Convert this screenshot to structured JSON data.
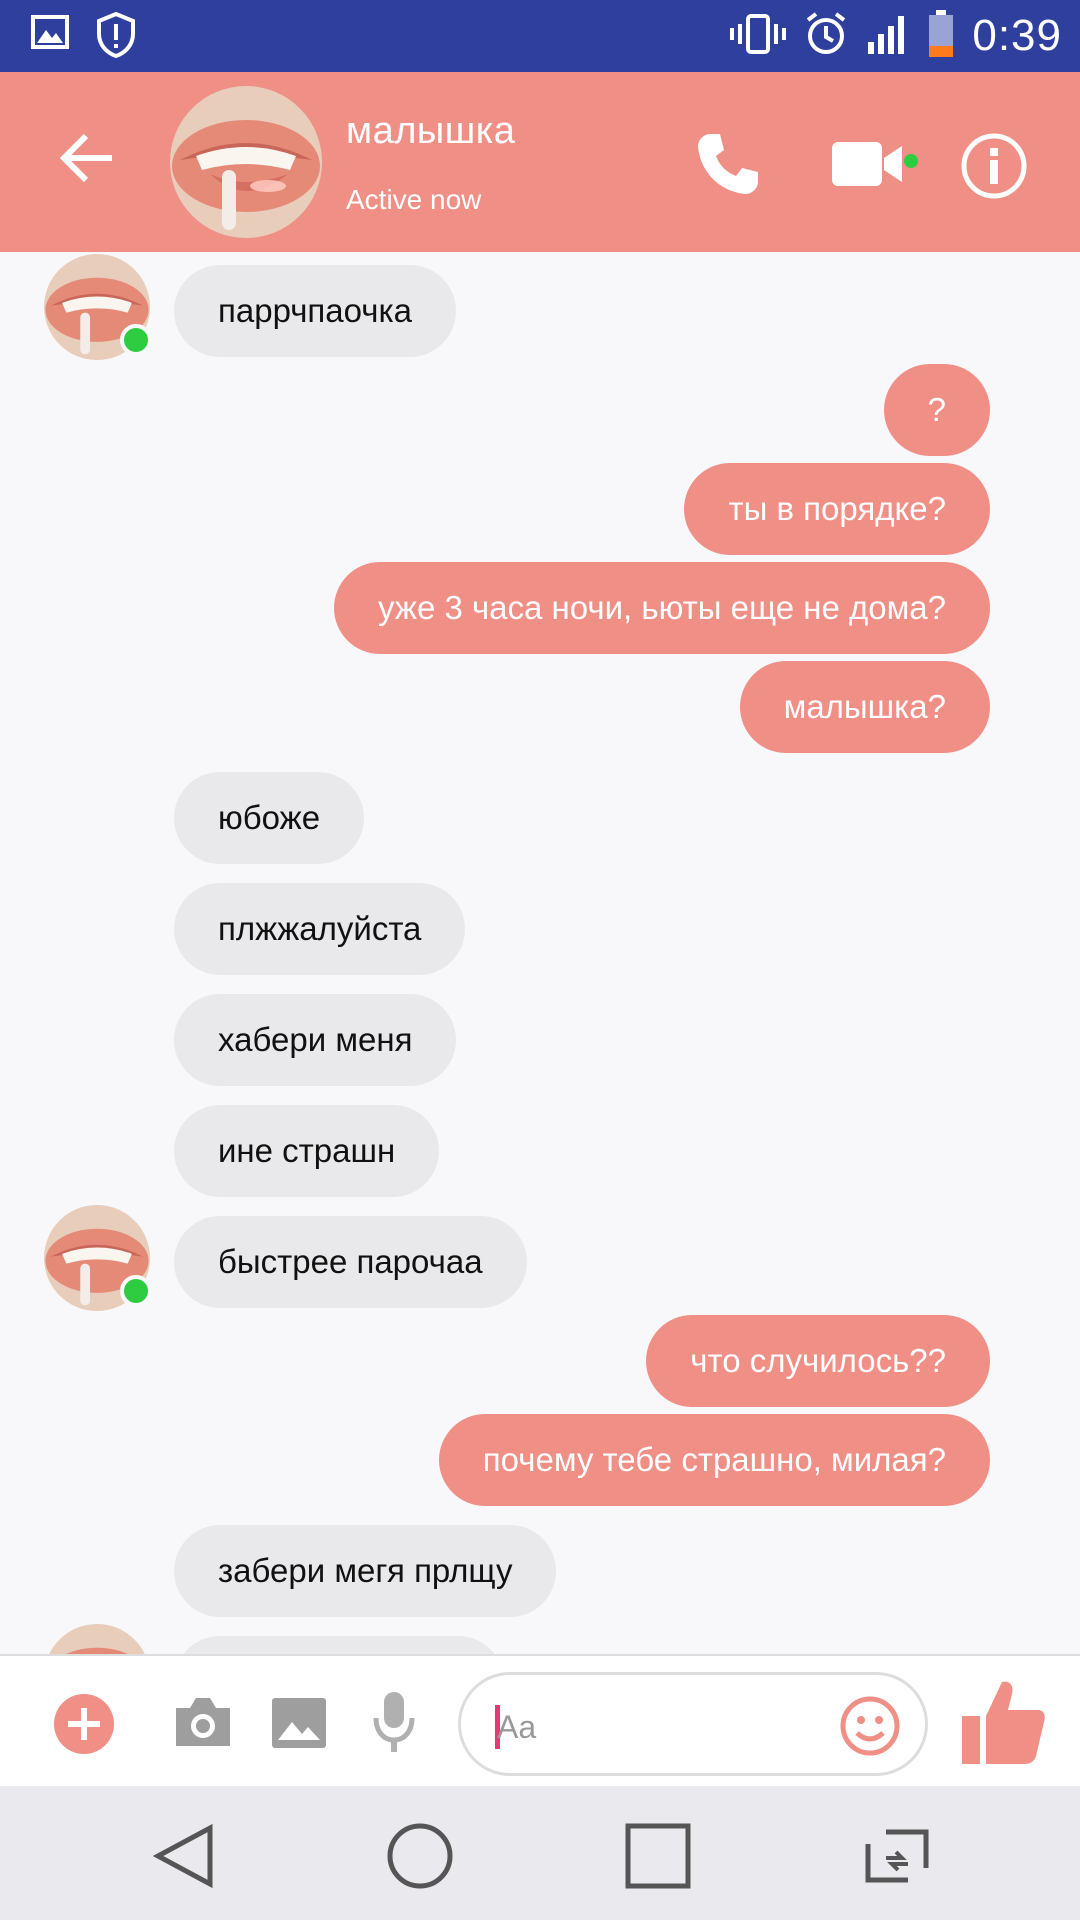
{
  "status_bar": {
    "time": "0:39",
    "icons": [
      "gallery-notification-icon",
      "shield-notification-icon",
      "vibrate-icon",
      "alarm-icon",
      "signal-icon",
      "battery-low-icon"
    ]
  },
  "header": {
    "contact_name": "малышка",
    "status": "Active now",
    "icons": [
      "back-arrow-icon",
      "phone-icon",
      "video-icon",
      "info-icon"
    ]
  },
  "messages": [
    {
      "side": "in",
      "text": "паррчпаочка",
      "avatar": true
    },
    {
      "side": "out",
      "text": "?"
    },
    {
      "side": "out",
      "text": "ты в порядке?"
    },
    {
      "side": "out",
      "text": "уже 3 часа ночи, ьюты еще не дома?"
    },
    {
      "side": "out",
      "text": "малышка?"
    },
    {
      "side": "in",
      "text": "юбоже"
    },
    {
      "side": "in",
      "text": "плжжалуйста"
    },
    {
      "side": "in",
      "text": "хабери меня"
    },
    {
      "side": "in",
      "text": "ине страшн"
    },
    {
      "side": "in",
      "text": "быстрее парочаа",
      "avatar": true
    },
    {
      "side": "out",
      "text": "что случилось??"
    },
    {
      "side": "out",
      "text": "почему тебе страшно, милая?"
    },
    {
      "side": "in",
      "text": "забери мегя прлщу"
    }
  ],
  "composer": {
    "placeholder": "Aa",
    "icons": [
      "plus-icon",
      "camera-icon",
      "gallery-icon",
      "microphone-icon",
      "emoji-icon",
      "thumbs-up-icon"
    ]
  },
  "colors": {
    "accent": "#ef8f86",
    "status_bar": "#2f3f9e",
    "incoming_bubble": "#e9e9eb",
    "online": "#2ecc40"
  }
}
